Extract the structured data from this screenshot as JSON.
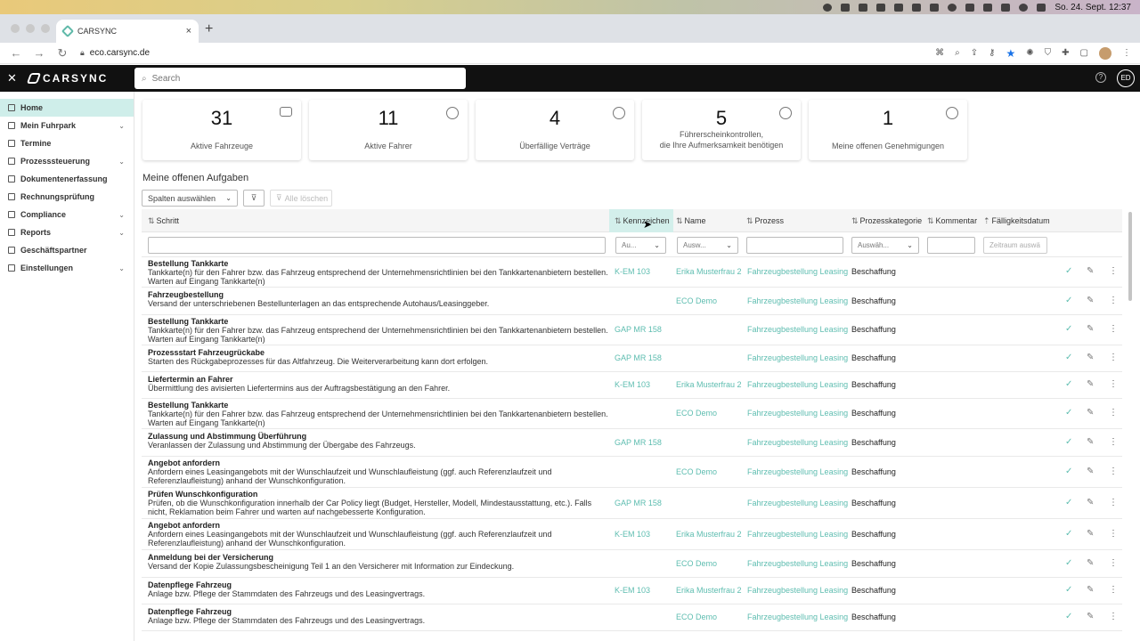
{
  "menubar": {
    "datetime": "So. 24. Sept.  12:37"
  },
  "browser": {
    "tab_title": "CARSYNC",
    "url": "eco.carsync.de"
  },
  "app": {
    "logo": "CARSYNC",
    "search_placeholder": "Search",
    "user_initials": "ED",
    "help": "?"
  },
  "sidebar": {
    "items": [
      {
        "label": "Home",
        "icon": "home-icon",
        "expandable": false,
        "active": true
      },
      {
        "label": "Mein Fuhrpark",
        "icon": "car-icon",
        "expandable": true,
        "active": false
      },
      {
        "label": "Termine",
        "icon": "calendar-icon",
        "expandable": false,
        "active": false
      },
      {
        "label": "Prozesssteuerung",
        "icon": "process-icon",
        "expandable": true,
        "active": false
      },
      {
        "label": "Dokumentenerfassung",
        "icon": "document-icon",
        "expandable": false,
        "active": false
      },
      {
        "label": "Rechnungsprüfung",
        "icon": "invoice-icon",
        "expandable": false,
        "active": false
      },
      {
        "label": "Compliance",
        "icon": "shield-icon",
        "expandable": true,
        "active": false
      },
      {
        "label": "Reports",
        "icon": "chart-icon",
        "expandable": true,
        "active": false
      },
      {
        "label": "Geschäftspartner",
        "icon": "partner-icon",
        "expandable": false,
        "active": false
      },
      {
        "label": "Einstellungen",
        "icon": "gear-icon",
        "expandable": true,
        "active": false
      }
    ]
  },
  "kpis": [
    {
      "value": "31",
      "label": "Aktive Fahrzeuge",
      "icon": "car-icon"
    },
    {
      "value": "11",
      "label": "Aktive Fahrer",
      "icon": "steering-wheel-icon"
    },
    {
      "value": "4",
      "label": "Überfällige Verträge",
      "icon": "clock-icon"
    },
    {
      "value": "5",
      "label_line1": "Führerscheinkontrollen,",
      "label_line2": "die Ihre Aufmerksamkeit benötigen",
      "icon": "license-alert-icon"
    },
    {
      "value": "1",
      "label": "Meine offenen Genehmigungen",
      "icon": "check-circle-icon"
    }
  ],
  "tasks": {
    "title": "Meine offenen Aufgaben",
    "columns_select": "Spalten auswählen",
    "clear_label": "Alle löschen",
    "headers": {
      "schritt": "Schritt",
      "kennzeichen": "Kennzeichen",
      "name": "Name",
      "prozess": "Prozess",
      "kategorie": "Prozesskategorie",
      "kommentar": "Kommentar",
      "faellig": "Fälligkeitsdatum"
    },
    "filters": {
      "kennzeichen": "Au...",
      "name": "Ausw...",
      "kategorie": "Auswäh...",
      "faellig": "Zeitraum auswä"
    },
    "rows": [
      {
        "title": "Bestellung Tankkarte",
        "desc": "Tankkarte(n) für den Fahrer bzw. das Fahrzeug entsprechend der Unternehmensrichtlinien bei den Tankkartenanbietern bestellen. Warten auf Eingang Tankkarte(n)",
        "kennzeichen": "K-EM 103",
        "name": "Erika Musterfrau 2",
        "prozess": "Fahrzeugbestellung Leasing",
        "kategorie": "Beschaffung"
      },
      {
        "title": "Fahrzeugbestellung",
        "desc": "Versand der unterschriebenen Bestellunterlagen an das entsprechende Autohaus/Leasinggeber.",
        "kennzeichen": "",
        "name": "ECO Demo",
        "prozess": "Fahrzeugbestellung Leasing",
        "kategorie": "Beschaffung"
      },
      {
        "title": "Bestellung Tankkarte",
        "desc": "Tankkarte(n) für den Fahrer bzw. das Fahrzeug entsprechend der Unternehmensrichtlinien bei den Tankkartenanbietern bestellen. Warten auf Eingang Tankkarte(n)",
        "kennzeichen": "GAP MR 158",
        "name": "",
        "prozess": "Fahrzeugbestellung Leasing",
        "kategorie": "Beschaffung"
      },
      {
        "title": "Prozessstart Fahrzeugrückabe",
        "desc": "Starten des Rückgabeprozesses für das Altfahrzeug. Die Weiterverarbeitung kann dort erfolgen.",
        "kennzeichen": "GAP MR 158",
        "name": "",
        "prozess": "Fahrzeugbestellung Leasing",
        "kategorie": "Beschaffung"
      },
      {
        "title": "Liefertermin an Fahrer",
        "desc": "Übermittlung des avisierten Liefertermins aus der Auftragsbestätigung an den Fahrer.",
        "kennzeichen": "K-EM 103",
        "name": "Erika Musterfrau 2",
        "prozess": "Fahrzeugbestellung Leasing",
        "kategorie": "Beschaffung"
      },
      {
        "title": "Bestellung Tankkarte",
        "desc": "Tankkarte(n) für den Fahrer bzw. das Fahrzeug entsprechend der Unternehmensrichtlinien bei den Tankkartenanbietern bestellen. Warten auf Eingang Tankkarte(n)",
        "kennzeichen": "",
        "name": "ECO Demo",
        "prozess": "Fahrzeugbestellung Leasing",
        "kategorie": "Beschaffung"
      },
      {
        "title": "Zulassung und Abstimmung Überführung",
        "desc": "Veranlassen der Zulassung und Abstimmung der Übergabe des Fahrzeugs.",
        "kennzeichen": "GAP MR 158",
        "name": "",
        "prozess": "Fahrzeugbestellung Leasing",
        "kategorie": "Beschaffung"
      },
      {
        "title": "Angebot anfordern",
        "desc": "Anfordern eines Leasingangebots mit der Wunschlaufzeit und Wunschlaufleistung (ggf. auch Referenzlaufzeit und Referenzlaufleistung) anhand der Wunschkonfiguration.",
        "kennzeichen": "",
        "name": "ECO Demo",
        "prozess": "Fahrzeugbestellung Leasing",
        "kategorie": "Beschaffung"
      },
      {
        "title": "Prüfen Wunschkonfiguration",
        "desc": "Prüfen, ob die Wunschkonfiguration innerhalb der Car Policy liegt (Budget, Hersteller, Modell, Mindestausstattung, etc.). Falls nicht, Reklamation beim Fahrer und warten auf nachgebesserte Konfiguration.",
        "kennzeichen": "GAP MR 158",
        "name": "",
        "prozess": "Fahrzeugbestellung Leasing",
        "kategorie": "Beschaffung"
      },
      {
        "title": "Angebot anfordern",
        "desc": "Anfordern eines Leasingangebots mit der Wunschlaufzeit und Wunschlaufleistung (ggf. auch Referenzlaufzeit und Referenzlaufleistung) anhand der Wunschkonfiguration.",
        "kennzeichen": "K-EM 103",
        "name": "Erika Musterfrau 2",
        "prozess": "Fahrzeugbestellung Leasing",
        "kategorie": "Beschaffung"
      },
      {
        "title": "Anmeldung bei der Versicherung",
        "desc": "Versand der Kopie Zulassungsbescheinigung Teil 1 an den Versicherer mit Information zur Eindeckung.",
        "kennzeichen": "",
        "name": "ECO Demo",
        "prozess": "Fahrzeugbestellung Leasing",
        "kategorie": "Beschaffung"
      },
      {
        "title": "Datenpflege Fahrzeug",
        "desc": "Anlage bzw. Pflege der Stammdaten des Fahrzeugs und des Leasingvertrags.",
        "kennzeichen": "K-EM 103",
        "name": "Erika Musterfrau 2",
        "prozess": "Fahrzeugbestellung Leasing",
        "kategorie": "Beschaffung"
      },
      {
        "title": "Datenpflege Fahrzeug",
        "desc": "Anlage bzw. Pflege der Stammdaten des Fahrzeugs und des Leasingvertrags.",
        "kennzeichen": "",
        "name": "ECO Demo",
        "prozess": "Fahrzeugbestellung Leasing",
        "kategorie": "Beschaffung"
      }
    ]
  },
  "colors": {
    "accent": "#5ebdb0",
    "active_bg": "#cfeeea",
    "header_bg": "#111111"
  }
}
